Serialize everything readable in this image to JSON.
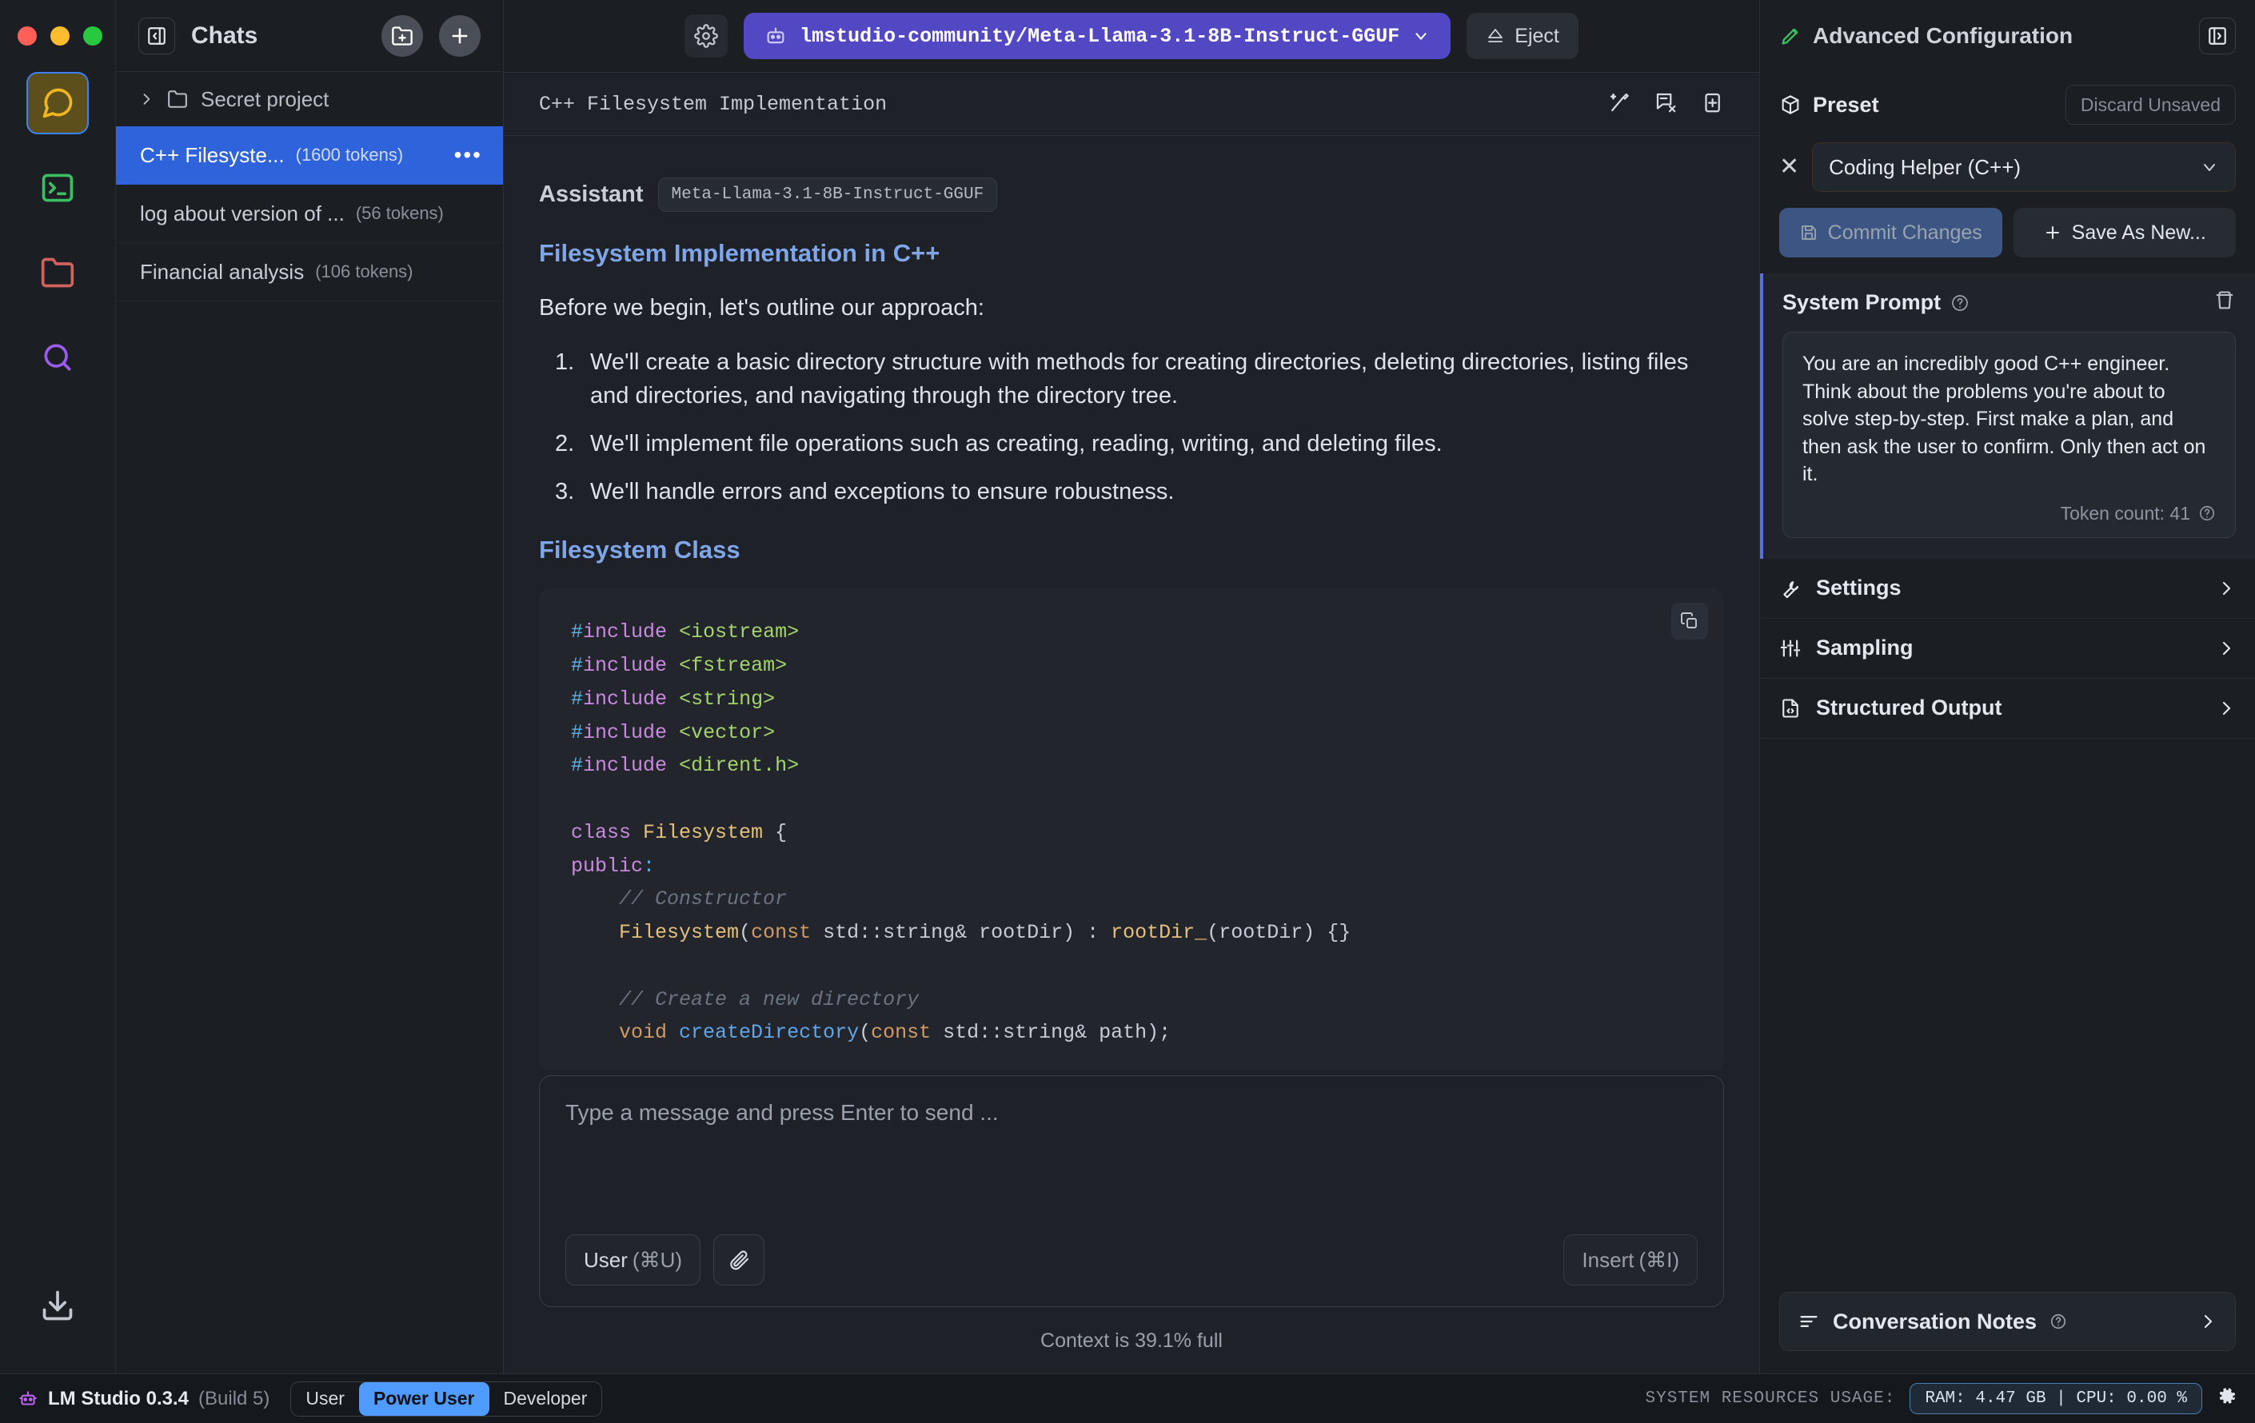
{
  "window": {
    "traffic_lights": [
      "close",
      "minimize",
      "maximize"
    ]
  },
  "sidebar_rail": {
    "items": [
      {
        "name": "chat",
        "icon": "chat-bubble-icon",
        "color": "#efb61f",
        "active": true
      },
      {
        "name": "developer",
        "icon": "terminal-icon",
        "color": "#3bbf63",
        "active": false
      },
      {
        "name": "my-models",
        "icon": "folder-icon",
        "color": "#d2635c",
        "active": false
      },
      {
        "name": "discover",
        "icon": "search-icon",
        "color": "#9b5cf0",
        "active": false
      }
    ],
    "bottom": {
      "name": "downloads",
      "icon": "download-icon"
    }
  },
  "chat_sidebar": {
    "title": "Chats",
    "new_folder_label": "+",
    "new_chat_label": "+",
    "folder": {
      "label": "Secret project",
      "expanded": false
    },
    "chats": [
      {
        "title": "C++ Filesyste...",
        "tokens": "(1600 tokens)",
        "selected": true,
        "menu": "•••"
      },
      {
        "title": "log about version of ...",
        "tokens": "(56 tokens)",
        "selected": false
      },
      {
        "title": "Financial analysis",
        "tokens": "(106 tokens)",
        "selected": false
      }
    ]
  },
  "topbar": {
    "model_name": "lmstudio-community/Meta-Llama-3.1-8B-Instruct-GGUF",
    "eject_label": "Eject",
    "right_panel_title": "Advanced Configuration"
  },
  "conversation": {
    "title": "C++ Filesystem Implementation",
    "message": {
      "role": "Assistant",
      "model_chip": "Meta-Llama-3.1-8B-Instruct-GGUF",
      "heading_1": "Filesystem Implementation in C++",
      "intro": "Before we begin, let's outline our approach:",
      "steps": [
        "We'll create a basic directory structure with methods for creating directories, deleting directories, listing files and directories, and navigating through the directory tree.",
        "We'll implement file operations such as creating, reading, writing, and deleting files.",
        "We'll handle errors and exceptions to ensure robustness."
      ],
      "heading_2": "Filesystem Class",
      "code_language": "cpp",
      "code_lines": [
        "#include <iostream>",
        "#include <fstream>",
        "#include <string>",
        "#include <vector>",
        "#include <dirent.h>",
        "",
        "class Filesystem {",
        "public:",
        "    // Constructor",
        "    Filesystem(const std::string& rootDir) : rootDir_(rootDir) {}",
        "",
        "    // Create a new directory",
        "    void createDirectory(const std::string& path);"
      ]
    }
  },
  "composer": {
    "placeholder": "Type a message and press Enter to send ...",
    "user_button": "User",
    "user_shortcut": "(⌘U)",
    "insert_button": "Insert",
    "insert_shortcut": "(⌘I)",
    "attach_icon": "paperclip-icon",
    "context_status": "Context is 39.1% full"
  },
  "right_panel": {
    "preset": {
      "section_label": "Preset",
      "discard_label": "Discard Unsaved",
      "selected": "Coding Helper (C++)",
      "commit_label": "Commit Changes",
      "save_as_new_label": "Save As New..."
    },
    "system_prompt": {
      "label": "System Prompt",
      "text": "You are an incredibly good C++ engineer. Think about the problems you're about to solve step-by-step. First make a plan, and then ask the user to confirm. Only then act on it.",
      "token_count": "Token count: 41"
    },
    "sections": [
      {
        "label": "Settings",
        "icon": "wrench-icon"
      },
      {
        "label": "Sampling",
        "icon": "sliders-icon"
      },
      {
        "label": "Structured Output",
        "icon": "file-code-icon"
      }
    ],
    "conversation_notes": {
      "label": "Conversation Notes",
      "icon": "notes-icon"
    }
  },
  "statusbar": {
    "app_version": "LM Studio 0.3.4",
    "build": "(Build 5)",
    "modes": [
      {
        "label": "User",
        "active": false
      },
      {
        "label": "Power User",
        "active": true
      },
      {
        "label": "Developer",
        "active": false
      }
    ],
    "resources_label": "SYSTEM RESOURCES USAGE:",
    "resources_value": "RAM: 4.47 GB  |  CPU: 0.00 %"
  },
  "colors": {
    "accent_blue": "#2f63dc",
    "model_purple": "#5348c4",
    "power_user_blue": "#4f9bff",
    "heading_blue": "#7fa6e8"
  }
}
